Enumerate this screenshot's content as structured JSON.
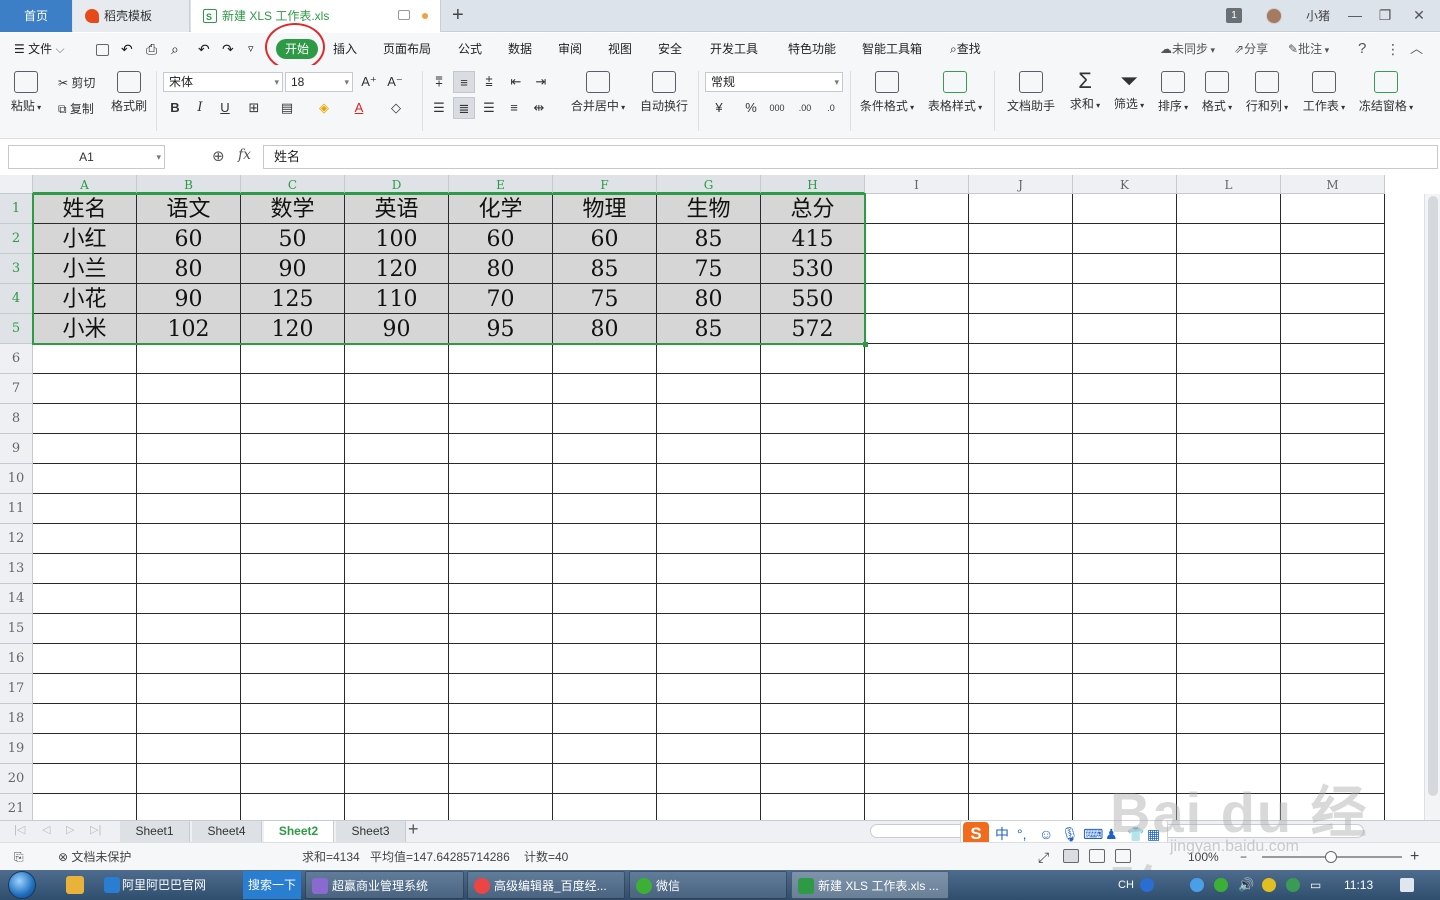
{
  "tabs": {
    "home": "首页",
    "template": "稻壳模板",
    "file": "新建 XLS 工作表.xls",
    "badge_count": "1",
    "user": "小猪"
  },
  "menu": {
    "file": "文件",
    "items": [
      "开始",
      "插入",
      "页面布局",
      "公式",
      "数据",
      "审阅",
      "视图",
      "安全",
      "开发工具",
      "特色功能",
      "智能工具箱"
    ],
    "search": "查找",
    "sync": "未同步",
    "share": "分享",
    "comment": "批注"
  },
  "ribbon": {
    "paste": "粘贴",
    "cut": "剪切",
    "copy": "复制",
    "format_painter": "格式刷",
    "font_name": "宋体",
    "font_size": "18",
    "merge": "合并居中",
    "wrap": "自动换行",
    "number_format": "常规",
    "conditional": "条件格式",
    "table_style": "表格样式",
    "doc_helper": "文档助手",
    "sum": "求和",
    "filter": "筛选",
    "sort": "排序",
    "format": "格式",
    "rowcol": "行和列",
    "worksheet": "工作表",
    "freeze": "冻结窗格"
  },
  "formula": {
    "cell_ref": "A1",
    "fx": "fx",
    "content": "姓名"
  },
  "grid": {
    "columns": [
      "A",
      "B",
      "C",
      "D",
      "E",
      "F",
      "G",
      "H",
      "I",
      "J",
      "K",
      "L",
      "M"
    ],
    "row_numbers": [
      "1",
      "2",
      "3",
      "4",
      "5",
      "6",
      "7",
      "8",
      "9",
      "10",
      "11",
      "12",
      "13",
      "14",
      "15",
      "16",
      "17",
      "18",
      "19",
      "20",
      "21"
    ],
    "data": [
      [
        "姓名",
        "语文",
        "数学",
        "英语",
        "化学",
        "物理",
        "生物",
        "总分"
      ],
      [
        "小红",
        "60",
        "50",
        "100",
        "60",
        "60",
        "85",
        "415"
      ],
      [
        "小兰",
        "80",
        "90",
        "120",
        "80",
        "85",
        "75",
        "530"
      ],
      [
        "小花",
        "90",
        "125",
        "110",
        "70",
        "75",
        "80",
        "550"
      ],
      [
        "小米",
        "102",
        "120",
        "90",
        "95",
        "80",
        "85",
        "572"
      ]
    ]
  },
  "sheets": {
    "tabs": [
      "Sheet1",
      "Sheet4",
      "Sheet2",
      "Sheet3"
    ],
    "active": "Sheet2"
  },
  "status": {
    "protect": "文档未保护",
    "sum": "求和=4134",
    "average": "平均值=147.64285714286",
    "count": "计数=40",
    "zoom": "100%"
  },
  "ime": {
    "mode": "中"
  },
  "watermark": {
    "text": "Bai du 经验",
    "sub": "jingyan.baidu.com"
  },
  "taskbar": {
    "search": "搜索一下",
    "tasks": [
      "阿里阿巴巴官网",
      "超赢商业管理系统",
      "高级编辑器_百度经...",
      "微信",
      "新建 XLS 工作表.xls ..."
    ],
    "lang": "CH",
    "time": "11:13"
  },
  "colors": {
    "accent_green": "#2e9a45",
    "highlight_red": "#e02a2a",
    "home_tab_blue": "#3c7fc6",
    "data_fill": "#d6d6d6"
  }
}
